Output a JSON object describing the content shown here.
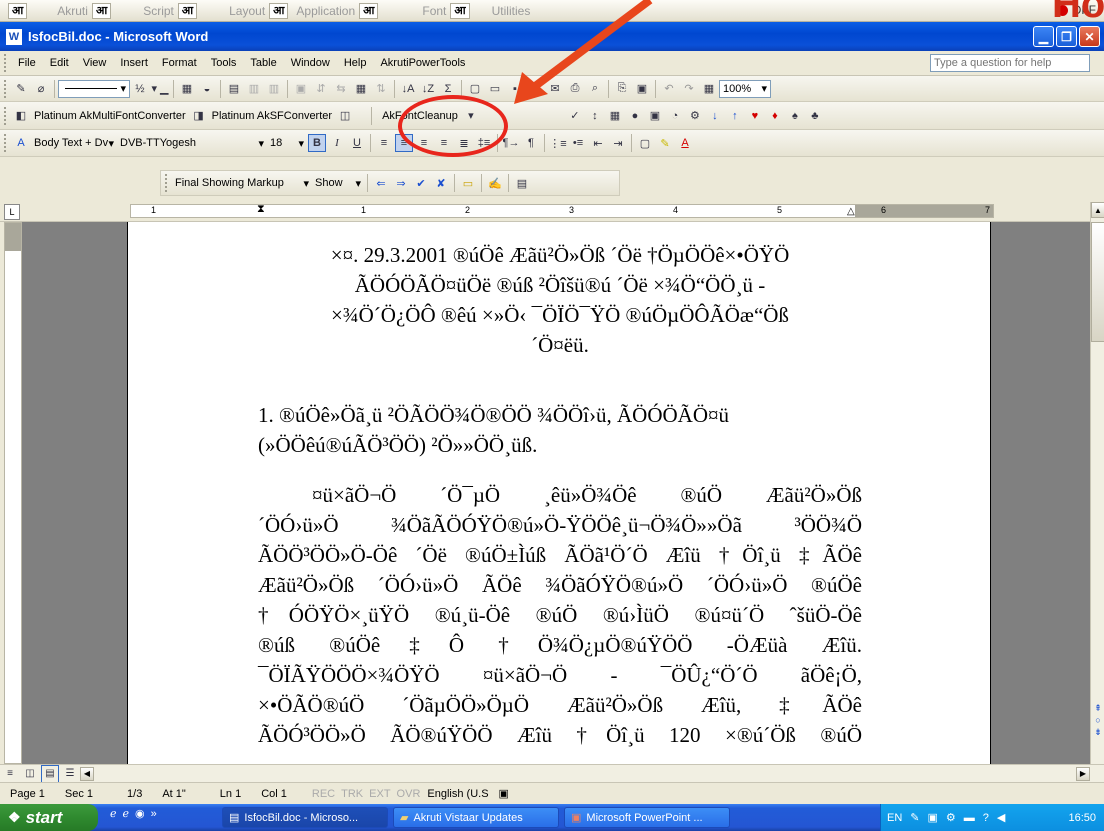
{
  "akruti_bar": {
    "items": [
      {
        "label": "आ",
        "box": ""
      },
      {
        "label": "Akruti",
        "box": "आ"
      },
      {
        "label": "Script",
        "box": "आ"
      },
      {
        "label": "Layout",
        "box": "आ"
      },
      {
        "label": "Application",
        "box": "आ"
      },
      {
        "label": "Font",
        "box": "आ"
      },
      {
        "label": "Utilities",
        "box": ""
      }
    ],
    "off_label": "OFF",
    "overlay_text": "Ho"
  },
  "window": {
    "title": "IsfocBil.doc - Microsoft Word"
  },
  "menu": {
    "items": [
      "File",
      "Edit",
      "View",
      "Insert",
      "Format",
      "Tools",
      "Table",
      "Window",
      "Help",
      "AkrutiPowerTools"
    ],
    "help_placeholder": "Type a question for help"
  },
  "toolbar1": {
    "zoom": "100%",
    "line_size": "½"
  },
  "toolbar2": {
    "btn1": "Platinum AkMultiFontConverter",
    "btn2": "Platinum AkSFConverter",
    "btn3": "AkFontCleanup"
  },
  "toolbar3": {
    "style": "Body Text + Dv",
    "font": "DVB-TTYogesh",
    "size": "18",
    "bold": "B",
    "italic": "I",
    "underline": "U"
  },
  "toolbar4": {
    "markup": "Final Showing Markup",
    "show": "Show"
  },
  "ruler": {
    "numbers": [
      "1",
      "1",
      "2",
      "3",
      "4",
      "5",
      "6",
      "7"
    ]
  },
  "document": {
    "heading_lines": [
      "×¤. 29.3.2001 ®úÖê Æãü²Ö»Öß ´Öë †ÖµÖÖê×•ÖŸÖ",
      "ÃÖÓÖÃÖ¤üÖë ®úß ²Öîšü®ú ´Öë ×¾Ö“ÖÖ¸ü -",
      "×¾Ö´Ö¿ÖÔ ®êú ×»Ö‹ ¯ÖÏÖ¯ŸÖ ®úÖµÖÔÃÖæ“Öß",
      "´Ö¤ëü."
    ],
    "section_lines": [
      "1.    ®úÖê»Öã¸ü ²ÖÃÖÖ¾Ö®ÖÖ ¾ÖÖî›ü, ÃÖÓÖÃÖ¤ü",
      "(»ÖÖêú®úÃÖ³ÖÖ) ²Ö»»ÖÖ¸üß."
    ],
    "body_lines": [
      "¤ü×ãÖ¬Ö  ´Ö¯µÖ  ¸êü»Ö¾Öê  ®úÖ  Æãü²Ö»Öß",
      "´ÖÓ›ü»Ö  ¾ÖãÃÖÓŸÖ®ú»Ö-ŸÖÖê¸ü¬Ö¾Ö»»Öã  ³ÖÖ¾Ö",
      "ÃÖÖ³ÖÖ»Ö-Öê ´Öë ®úÖ±Ìúß ÃÖã¹Ö´Ö Æîü †Öî¸ü ‡ÃÖê",
      "Æãü²Ö»Öß ´ÖÓ›ü»Ö ÃÖê ¾ÖãÓŸÖ®ú»Ö ´ÖÓ›ü»Ö ®úÖê",
      "†ÓÖŸÖ×¸üŸÖ ®ú¸ü-Öê ®úÖ ®ú›ÌüÖ ®ú¤ü´Ö ˆšüÖ-Öê",
      "®úß  ®úÖê‡Ô  †Ö¾Ö¿µÖ®úŸÖÖ  -ÖÆüà  Æîü.",
      "¯ÖÏÃŸÖÖÖ×¾ÖŸÖ  ¤ü×ãÖ¬Ö  -  ¯ÖÛ¿“Ö´Ö  ãÖê¡Ö,",
      "×•ÖÃÖ®úÖ  ´ÖãµÖÖ»ÖµÖ  Æãü²Ö»Öß  Æîü, ‡ÃÖê",
      "ÃÖÓ³ÖÖ»Ö ÃÖ®úŸÖÖ Æîü †Öî¸ü 120 ×®ú´Öß ®úÖ"
    ]
  },
  "status": {
    "page": "Page 1",
    "sec": "Sec 1",
    "pages": "1/3",
    "at": "At 1\"",
    "ln": "Ln 1",
    "col": "Col 1",
    "rec": "REC",
    "trk": "TRK",
    "ext": "EXT",
    "ovr": "OVR",
    "lang": "English (U.S"
  },
  "taskbar": {
    "start": "start",
    "tasks": [
      "IsfocBil.doc - Microso...",
      "Akruti Vistaar Updates",
      "Microsoft PowerPoint ..."
    ],
    "tray_lang": "EN",
    "clock": "16:50"
  }
}
